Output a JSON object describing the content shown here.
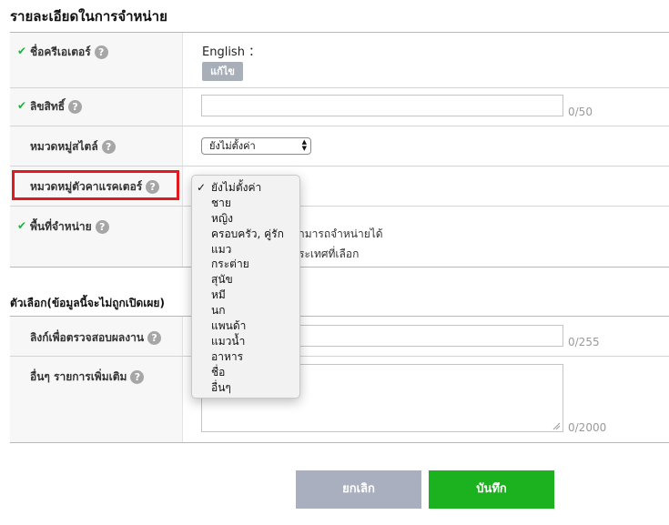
{
  "page_title": "รายละเอียดในการจำหน่าย",
  "help_glyph": "?",
  "check_glyph": "✔",
  "rows": {
    "creator_name": {
      "label": "ชื่อครีเอเตอร์",
      "value_label": "English ：",
      "edit_button": "แก้ไข"
    },
    "copyright": {
      "label": "ลิขสิทธิ์",
      "value": "",
      "counter": "0/50"
    },
    "style_category": {
      "label": "หมวดหมู่สไตล์",
      "selected": "ยังไม่ตั้งค่า"
    },
    "character_category": {
      "label": "หมวดหมู่ตัวคาแรคเตอร์"
    },
    "sales_region": {
      "label": "พื้นที่จำหน่าย",
      "line1": "ามารถจำหน่ายได้",
      "line2": "ระเทศที่เลือก"
    }
  },
  "optional_section": {
    "heading": "ตัวเลือก(ข้อมูลนี้จะไม่ถูกเปิดเผย)",
    "verification_link": {
      "label": "ลิงก์เพื่อตรวจสอบผลงาน",
      "value": "",
      "counter": "0/255"
    },
    "other_notes": {
      "label": "อื่นๆ รายการเพิ่มเติม",
      "value": "",
      "counter": "0/2000"
    }
  },
  "dropdown": {
    "options": [
      "ยังไม่ตั้งค่า",
      "ชาย",
      "หญิง",
      "ครอบครัว, คู่รัก",
      "แมว",
      "กระต่าย",
      "สุนัข",
      "หมี",
      "นก",
      "แพนด้า",
      "แมวน้ำ",
      "อาหาร",
      "ชื่อ",
      "อื่นๆ"
    ],
    "selected_index": 0,
    "checkmark": "✓"
  },
  "buttons": {
    "cancel": "ยกเลิก",
    "save": "บันทึก"
  },
  "colors": {
    "check": "#1db33b",
    "highlight_border": "#e3191e",
    "save_button": "#1bb11f",
    "cancel_button": "#a9afbf",
    "edit_button": "#a9afb9"
  }
}
